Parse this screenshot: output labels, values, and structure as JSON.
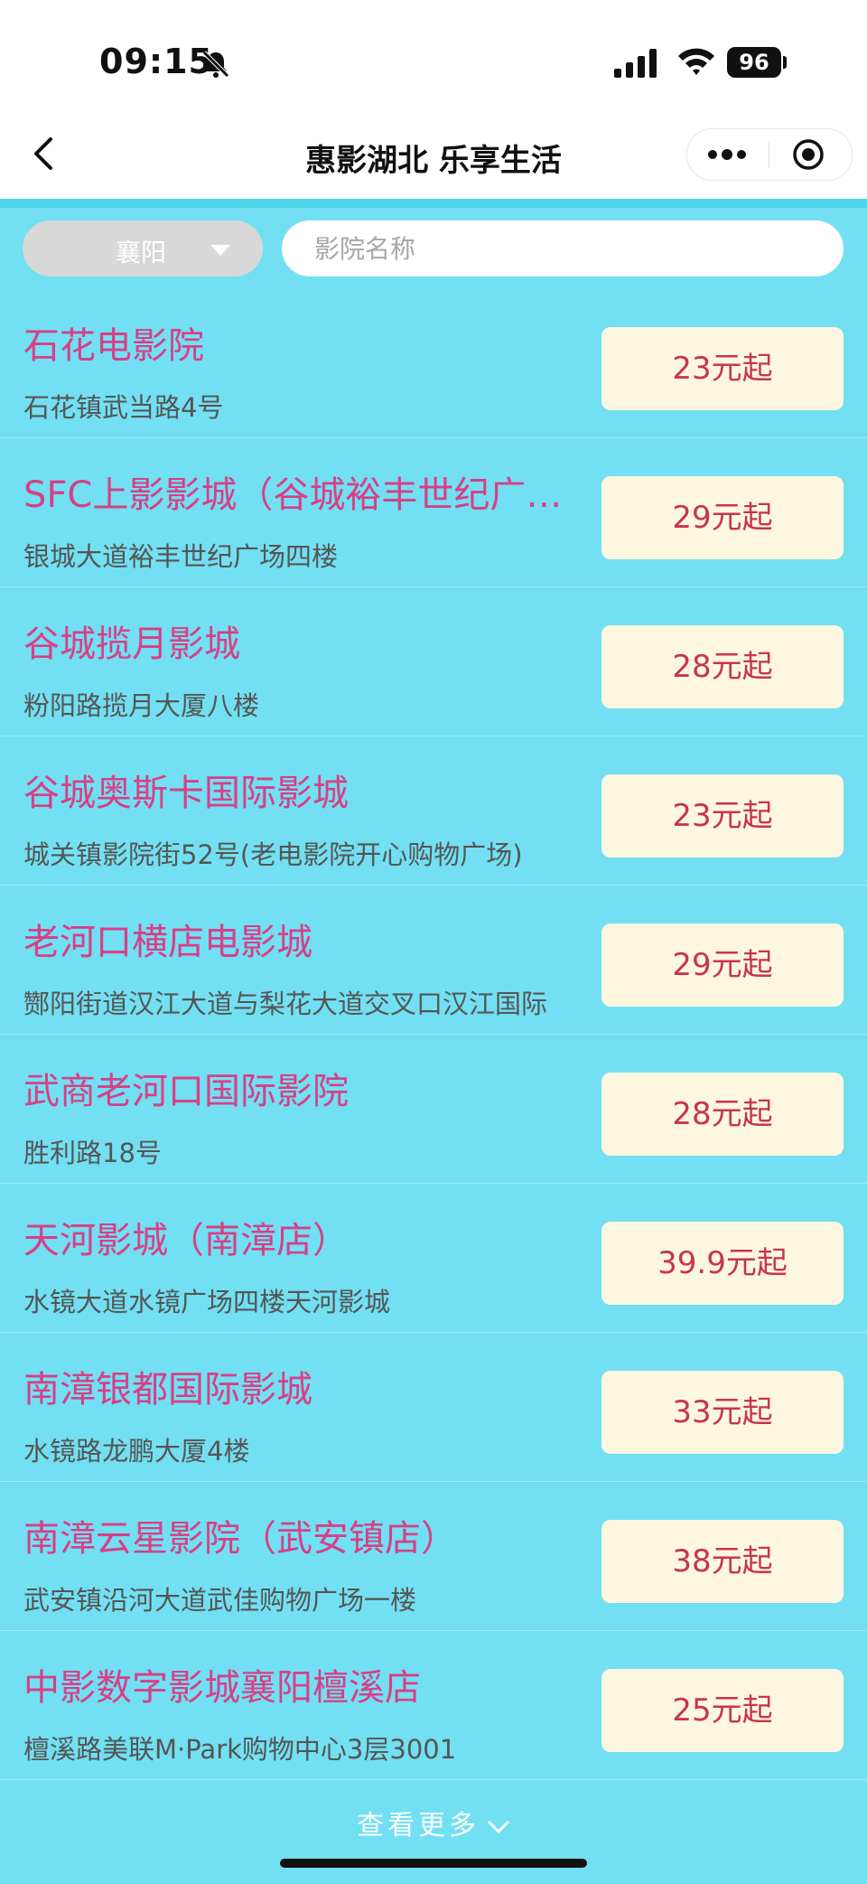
{
  "status_bar": {
    "time": "09:15",
    "battery": "96"
  },
  "nav": {
    "title": "惠影湖北 乐享生活"
  },
  "filters": {
    "city": "襄阳",
    "search_placeholder": "影院名称"
  },
  "cinemas": [
    {
      "name": "石花电影院",
      "address": "石花镇武当路4号",
      "price": "23元起"
    },
    {
      "name": "SFC上影影城（谷城裕丰世纪广场店）",
      "address": "银城大道裕丰世纪广场四楼",
      "price": "29元起"
    },
    {
      "name": "谷城揽月影城",
      "address": "粉阳路揽月大厦八楼",
      "price": "28元起"
    },
    {
      "name": "谷城奥斯卡国际影城",
      "address": "城关镇影院街52号(老电影院开心购物广场)",
      "price": "23元起"
    },
    {
      "name": "老河口横店电影城",
      "address": "酂阳街道汉江大道与梨花大道交叉口汉江国际",
      "price": "29元起"
    },
    {
      "name": "武商老河口国际影院",
      "address": "胜利路18号",
      "price": "28元起"
    },
    {
      "name": "天河影城（南漳店）",
      "address": "水镜大道水镜广场四楼天河影城",
      "price": "39.9元起"
    },
    {
      "name": "南漳银都国际影城",
      "address": "水镜路龙鹏大厦4楼",
      "price": "33元起"
    },
    {
      "name": "南漳云星影院（武安镇店）",
      "address": "武安镇沿河大道武佳购物广场一楼",
      "price": "38元起"
    },
    {
      "name": "中影数字影城襄阳檀溪店",
      "address": "檀溪路美联M·Park购物中心3层3001",
      "price": "25元起"
    }
  ],
  "footer": {
    "see_more": "查看更多"
  },
  "colors": {
    "background": "#72e0f2",
    "name": "#d83f86",
    "price_bg": "#fdf7df",
    "price_text": "#c8344f"
  }
}
